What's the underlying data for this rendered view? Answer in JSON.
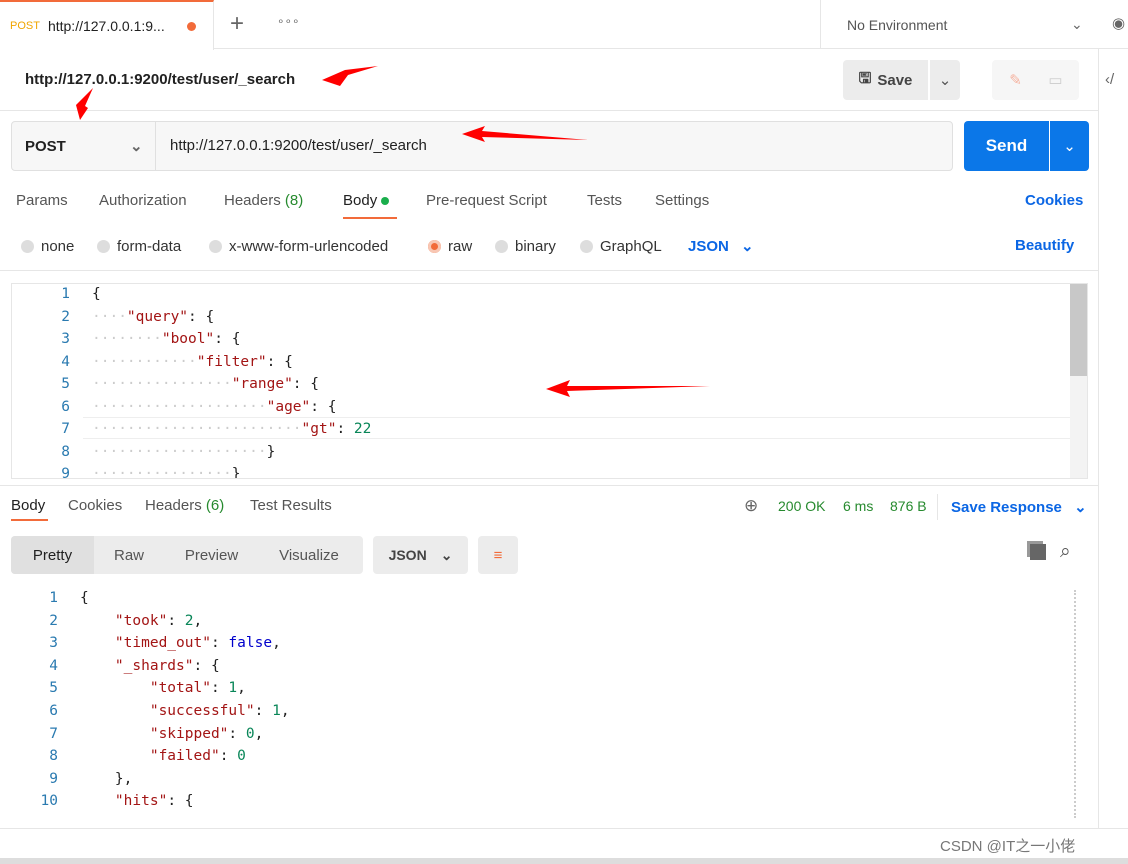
{
  "tab": {
    "method": "POST",
    "title": "http://127.0.0.1:9...",
    "plus": "+",
    "more": "∘∘∘"
  },
  "environment": "No Environment",
  "request": {
    "name": "http://127.0.0.1:9200/test/user/_search",
    "save": "Save",
    "method": "POST",
    "url": "http://127.0.0.1:9200/test/user/_search",
    "send": "Send"
  },
  "req_tabs": {
    "params": "Params",
    "authorization": "Authorization",
    "headers": "Headers",
    "headers_count": "(8)",
    "body": "Body",
    "prerequest": "Pre-request Script",
    "tests": "Tests",
    "settings": "Settings",
    "cookies": "Cookies"
  },
  "body_types": [
    "none",
    "form-data",
    "x-www-form-urlencoded",
    "raw",
    "binary",
    "GraphQL"
  ],
  "body_format": "JSON",
  "beautify": "Beautify",
  "request_body": [
    {
      "n": "1",
      "i": 0,
      "t": [
        [
          "p",
          "{"
        ]
      ]
    },
    {
      "n": "2",
      "i": 1,
      "t": [
        [
          "k",
          "\"query\""
        ],
        [
          "p",
          ": {"
        ]
      ]
    },
    {
      "n": "3",
      "i": 2,
      "t": [
        [
          "k",
          "\"bool\""
        ],
        [
          "p",
          ": {"
        ]
      ]
    },
    {
      "n": "4",
      "i": 3,
      "t": [
        [
          "k",
          "\"filter\""
        ],
        [
          "p",
          ": {"
        ]
      ]
    },
    {
      "n": "5",
      "i": 4,
      "t": [
        [
          "k",
          "\"range\""
        ],
        [
          "p",
          ": {"
        ]
      ]
    },
    {
      "n": "6",
      "i": 5,
      "t": [
        [
          "k",
          "\"age\""
        ],
        [
          "p",
          ": {"
        ]
      ]
    },
    {
      "n": "7",
      "i": 6,
      "t": [
        [
          "k",
          "\"gt\""
        ],
        [
          "p",
          ": "
        ],
        [
          "n",
          "22"
        ]
      ]
    },
    {
      "n": "8",
      "i": 5,
      "t": [
        [
          "p",
          "}"
        ]
      ]
    },
    {
      "n": "9",
      "i": 4,
      "t": [
        [
          "p",
          "}"
        ]
      ]
    }
  ],
  "resp_tabs": {
    "body": "Body",
    "cookies": "Cookies",
    "headers": "Headers",
    "headers_count": "(6)",
    "tests": "Test Results"
  },
  "status": {
    "code": "200 OK",
    "time": "6 ms",
    "size": "876 B",
    "save_response": "Save Response"
  },
  "view_tabs": [
    "Pretty",
    "Raw",
    "Preview",
    "Visualize"
  ],
  "resp_format": "JSON",
  "response_body": [
    {
      "n": "1",
      "i": 0,
      "t": [
        [
          "p",
          "{"
        ]
      ]
    },
    {
      "n": "2",
      "i": 1,
      "t": [
        [
          "k",
          "\"took\""
        ],
        [
          "p",
          ": "
        ],
        [
          "n",
          "2"
        ],
        [
          "p",
          ","
        ]
      ]
    },
    {
      "n": "3",
      "i": 1,
      "t": [
        [
          "k",
          "\"timed_out\""
        ],
        [
          "p",
          ": "
        ],
        [
          "b",
          "false"
        ],
        [
          "p",
          ","
        ]
      ]
    },
    {
      "n": "4",
      "i": 1,
      "t": [
        [
          "k",
          "\"_shards\""
        ],
        [
          "p",
          ": {"
        ]
      ]
    },
    {
      "n": "5",
      "i": 2,
      "t": [
        [
          "k",
          "\"total\""
        ],
        [
          "p",
          ": "
        ],
        [
          "n",
          "1"
        ],
        [
          "p",
          ","
        ]
      ]
    },
    {
      "n": "6",
      "i": 2,
      "t": [
        [
          "k",
          "\"successful\""
        ],
        [
          "p",
          ": "
        ],
        [
          "n",
          "1"
        ],
        [
          "p",
          ","
        ]
      ]
    },
    {
      "n": "7",
      "i": 2,
      "t": [
        [
          "k",
          "\"skipped\""
        ],
        [
          "p",
          ": "
        ],
        [
          "n",
          "0"
        ],
        [
          "p",
          ","
        ]
      ]
    },
    {
      "n": "8",
      "i": 2,
      "t": [
        [
          "k",
          "\"failed\""
        ],
        [
          "p",
          ": "
        ],
        [
          "n",
          "0"
        ]
      ]
    },
    {
      "n": "9",
      "i": 1,
      "t": [
        [
          "p",
          "},"
        ]
      ]
    },
    {
      "n": "10",
      "i": 1,
      "t": [
        [
          "k",
          "\"hits\""
        ],
        [
          "p",
          ": {"
        ]
      ]
    }
  ],
  "footer": {
    "watermark": "CSDN @IT之一小佬"
  }
}
